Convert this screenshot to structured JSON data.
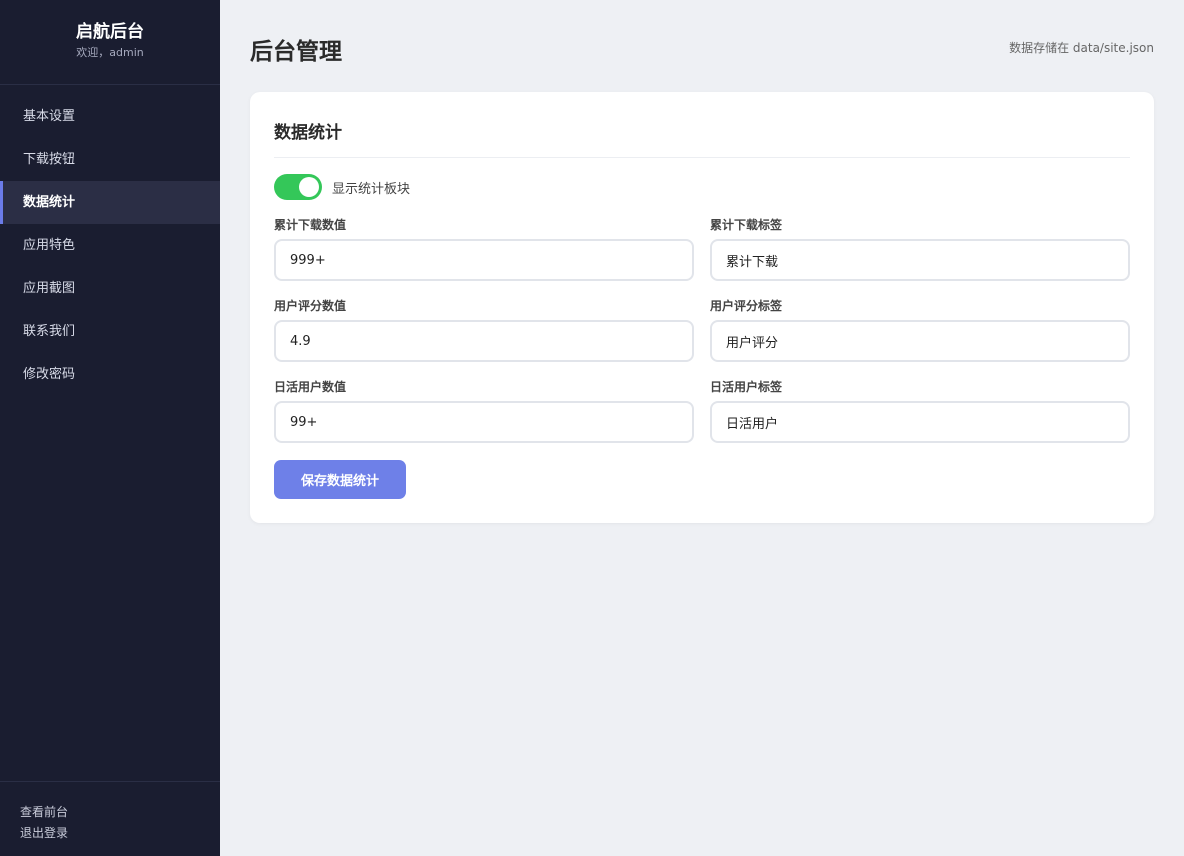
{
  "sidebar": {
    "brand_title": "启航后台",
    "brand_sub": "欢迎，admin",
    "items": [
      {
        "label": "基本设置"
      },
      {
        "label": "下载按钮"
      },
      {
        "label": "数据统计"
      },
      {
        "label": "应用特色"
      },
      {
        "label": "应用截图"
      },
      {
        "label": "联系我们"
      },
      {
        "label": "修改密码"
      }
    ],
    "active_index": 2,
    "footer": {
      "view_frontend": "查看前台",
      "logout": "退出登录"
    }
  },
  "header": {
    "title": "后台管理",
    "storage_note": "数据存储在 data/site.json"
  },
  "card": {
    "title": "数据统计",
    "toggle_label": "显示统计板块",
    "toggle_on": true,
    "fields": {
      "downloads_value": {
        "label": "累计下载数值",
        "value": "999+"
      },
      "downloads_label": {
        "label": "累计下载标签",
        "value": "累计下载"
      },
      "rating_value": {
        "label": "用户评分数值",
        "value": "4.9"
      },
      "rating_label": {
        "label": "用户评分标签",
        "value": "用户评分"
      },
      "dau_value": {
        "label": "日活用户数值",
        "value": "99+"
      },
      "dau_label": {
        "label": "日活用户标签",
        "value": "日活用户"
      }
    },
    "save_label": "保存数据统计"
  },
  "colors": {
    "sidebar_bg": "#1a1d30",
    "accent": "#6e80e8",
    "toggle_on": "#34c759",
    "page_bg": "#eef0f4"
  }
}
